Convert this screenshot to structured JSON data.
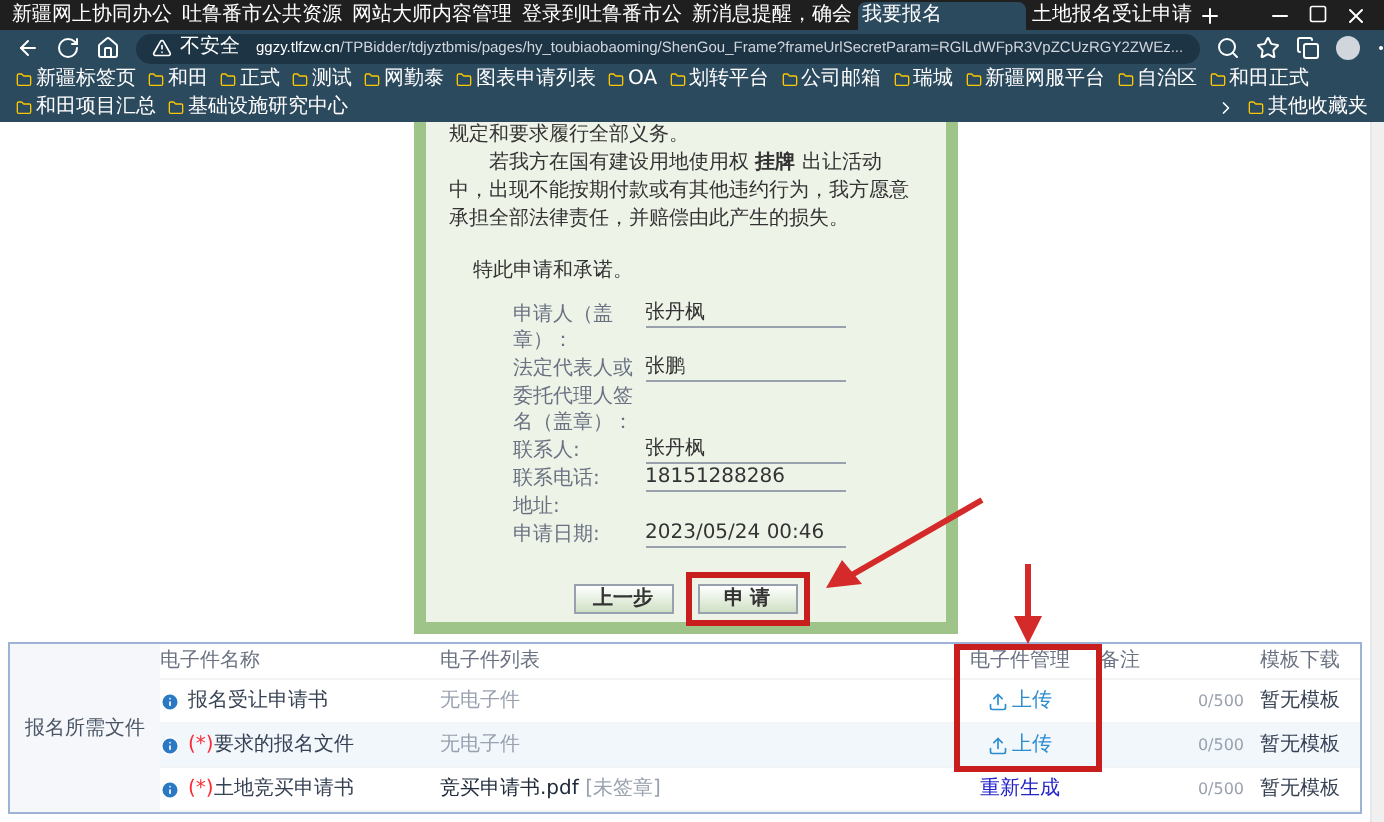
{
  "browser": {
    "tabs": [
      {
        "title": "新疆网上协同办公",
        "selected": false
      },
      {
        "title": "吐鲁番市公共资源",
        "selected": false
      },
      {
        "title": "网站大师内容管理",
        "selected": false
      },
      {
        "title": "登录到吐鲁番市公",
        "selected": false
      },
      {
        "title": "新消息提醒，确会",
        "selected": false
      },
      {
        "title": "我要报名",
        "selected": true
      },
      {
        "title": "土地报名受让申请",
        "selected": false
      }
    ],
    "security": "不安全",
    "url_host": "ggzy.tlfzw.cn",
    "url_path": "/TPBidder/tdjyztbmis/pages/hy_toubiaobaoming/ShenGou_Frame?frameUrlSecretParam=RGlLdWFpR3VpZCUzRGY2ZWEz...",
    "bookmarks": [
      "新疆标签页",
      "和田",
      "正式",
      "测试",
      "网勤泰",
      "图表申请列表",
      "OA",
      "划转平台",
      "公司邮箱",
      "瑞城",
      "新疆网服平台",
      "自治区",
      "和田正式",
      "和田项目汇总",
      "基础设施研究中心"
    ],
    "other_bookmarks": "其他收藏夹"
  },
  "certificate": {
    "paragraphs": [
      "规定和要求履行全部义务。",
      "若我方在国有建设用地使用权 **挂牌** 出让活动中，出现不能按期付款或有其他违约行为，我方愿意承担全部法律责任，并赔偿由此产生的损失。"
    ],
    "closing": "特此申请和承诺。",
    "fields": [
      {
        "label": "申请人（盖章）：",
        "value": "张丹枫"
      },
      {
        "label": "法定代表人或",
        "value": "张鹏"
      },
      {
        "label": "委托代理人签名（盖章）："
      },
      {
        "label": "联系人:",
        "value": "张丹枫"
      },
      {
        "label": "联系电话:",
        "value": "18151288286"
      },
      {
        "label": "地址:"
      },
      {
        "label": "申请日期:",
        "value": "2023/05/24 00:46"
      }
    ],
    "buttons": [
      "上一步",
      "申 请"
    ]
  },
  "files": {
    "section": "报名所需文件",
    "columns": [
      "电子件名称",
      "电子件列表",
      "电子件管理",
      "备注",
      "模板下载"
    ],
    "rows": [
      {
        "name": "报名受让申请书",
        "required": false,
        "file": "无电子件",
        "action": "上传",
        "kind": "upload",
        "counter": "0/500",
        "template": "暂无模板",
        "selected": false
      },
      {
        "name": "要求的报名文件",
        "required": true,
        "file": "无电子件",
        "action": "上传",
        "kind": "upload",
        "counter": "0/500",
        "template": "暂无模板",
        "selected": true
      },
      {
        "name": "土地竞买申请书",
        "required": true,
        "file": "竞买申请书.pdf",
        "file_status": "[未签章]",
        "action": "重新生成",
        "kind": "regenerate",
        "counter": "0/500",
        "template": "暂无模板",
        "selected": false
      }
    ],
    "required_mark": "(*)"
  }
}
